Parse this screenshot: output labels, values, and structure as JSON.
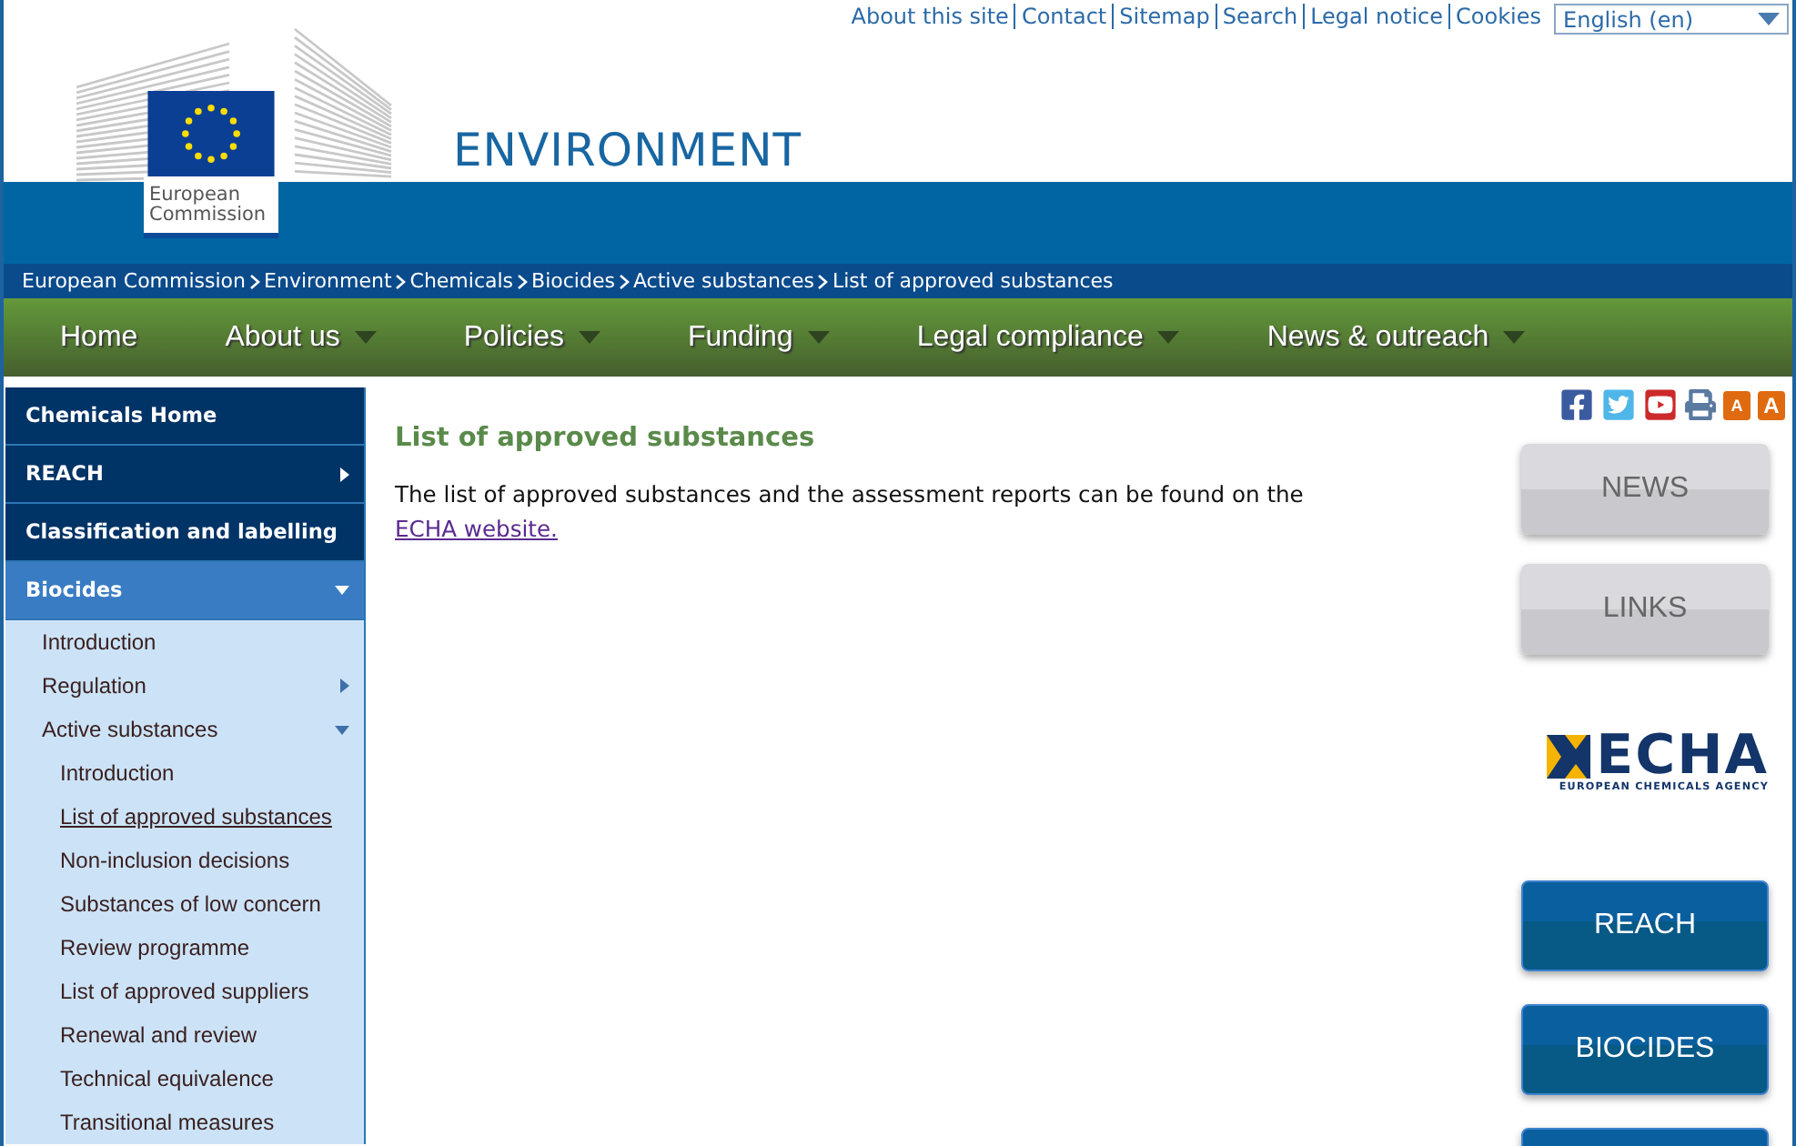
{
  "header": {
    "logo_text": "European Commission",
    "site_title": "ENVIRONMENT"
  },
  "top_links": [
    "About this site",
    "Contact",
    "Sitemap",
    "Search",
    "Legal notice",
    "Cookies"
  ],
  "language": {
    "value": "English (en)"
  },
  "breadcrumb": [
    "European Commission",
    "Environment",
    "Chemicals",
    "Biocides",
    "Active substances",
    "List of approved substances"
  ],
  "nav": [
    {
      "label": "Home",
      "has_menu": false
    },
    {
      "label": "About us",
      "has_menu": true
    },
    {
      "label": "Policies",
      "has_menu": true
    },
    {
      "label": "Funding",
      "has_menu": true
    },
    {
      "label": "Legal compliance",
      "has_menu": true
    },
    {
      "label": "News & outreach",
      "has_menu": true
    }
  ],
  "sidebar": {
    "items": [
      {
        "label": "Chemicals Home",
        "submenu": false,
        "expanded": false,
        "selected": false
      },
      {
        "label": "REACH",
        "submenu": true,
        "expanded": false,
        "selected": false
      },
      {
        "label": "Classification and labelling",
        "submenu": false,
        "expanded": false,
        "selected": false
      },
      {
        "label": "Biocides",
        "submenu": true,
        "expanded": true,
        "selected": true,
        "children": [
          {
            "label": "Introduction",
            "submenu": false,
            "expanded": false,
            "selected": false
          },
          {
            "label": "Regulation",
            "submenu": true,
            "expanded": false,
            "selected": false
          },
          {
            "label": "Active substances",
            "submenu": true,
            "expanded": true,
            "selected": false,
            "children": [
              {
                "label": "Introduction",
                "submenu": false,
                "expanded": false,
                "selected": false
              },
              {
                "label": "List of approved substances",
                "submenu": false,
                "expanded": false,
                "selected": true
              },
              {
                "label": "Non-inclusion decisions",
                "submenu": false,
                "expanded": false,
                "selected": false
              },
              {
                "label": "Substances of low concern",
                "submenu": false,
                "expanded": false,
                "selected": false
              },
              {
                "label": "Review programme",
                "submenu": false,
                "expanded": false,
                "selected": false
              },
              {
                "label": "List of approved suppliers",
                "submenu": false,
                "expanded": false,
                "selected": false
              },
              {
                "label": "Renewal and review",
                "submenu": false,
                "expanded": false,
                "selected": false
              },
              {
                "label": "Technical equivalence",
                "submenu": false,
                "expanded": false,
                "selected": false
              },
              {
                "label": "Transitional measures",
                "submenu": false,
                "expanded": false,
                "selected": false
              }
            ]
          }
        ]
      }
    ]
  },
  "content": {
    "heading": "List of approved substances",
    "text": "The list of approved substances and the assessment reports can be found on the",
    "link": "ECHA website."
  },
  "tools": [
    {
      "kind": "facebook"
    },
    {
      "kind": "twitter"
    },
    {
      "kind": "youtube"
    },
    {
      "kind": "print"
    },
    {
      "kind": "font-small",
      "label": "A"
    },
    {
      "kind": "font-large",
      "label": "A"
    }
  ],
  "side_buttons": [
    {
      "kind": "grey",
      "label": "NEWS"
    },
    {
      "kind": "grey",
      "label": "LINKS"
    },
    {
      "kind": "logo",
      "label": "ECHA",
      "caption": "EUROPEAN CHEMICALS AGENCY"
    },
    {
      "kind": "blue",
      "label": "REACH"
    },
    {
      "kind": "blue",
      "label": "BIOCIDES"
    },
    {
      "kind": "blue"
    }
  ]
}
